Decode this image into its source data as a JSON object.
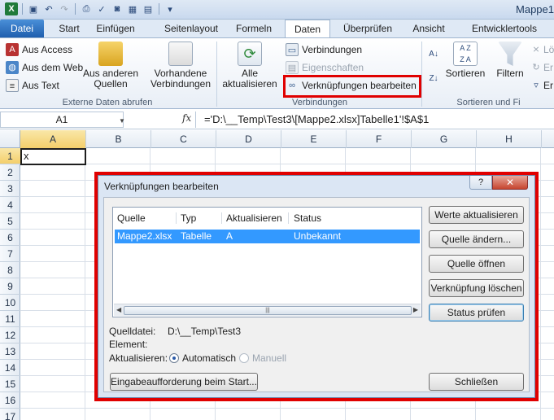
{
  "window": {
    "title": "Mappe1"
  },
  "tabs": [
    {
      "label": "Datei"
    },
    {
      "label": "Start"
    },
    {
      "label": "Einfügen"
    },
    {
      "label": "Seitenlayout"
    },
    {
      "label": "Formeln"
    },
    {
      "label": "Daten"
    },
    {
      "label": "Überprüfen"
    },
    {
      "label": "Ansicht"
    },
    {
      "label": "Entwicklertools"
    }
  ],
  "ribbon": {
    "external": {
      "access": "Aus Access",
      "web": "Aus dem Web",
      "text": "Aus Text",
      "other": "Aus anderen Quellen",
      "existing": "Vorhandene Verbindungen",
      "group_label": "Externe Daten abrufen"
    },
    "connections": {
      "refresh_all": "Alle aktualisieren",
      "connections": "Verbindungen",
      "properties": "Eigenschaften",
      "edit_links": "Verknüpfungen bearbeiten",
      "group_label": "Verbindungen"
    },
    "sort": {
      "sort_label": "Sortieren",
      "filter_label": "Filtern",
      "delete_partial": "Lö",
      "reapply_partial": "Er",
      "advanced_partial": "Er",
      "group_label": "Sortieren und Fi"
    }
  },
  "formula_bar": {
    "name_box": "A1",
    "fx": "fx",
    "formula": "='D:\\__Temp\\Test3\\[Mappe2.xlsx]Tabelle1'!$A$1"
  },
  "grid": {
    "columns": [
      "A",
      "B",
      "C",
      "D",
      "E",
      "F",
      "G",
      "H"
    ],
    "rows": [
      "1",
      "2",
      "3",
      "4",
      "5",
      "6",
      "7",
      "8",
      "9",
      "10",
      "11",
      "12",
      "13",
      "14",
      "15",
      "16",
      "17"
    ],
    "a1_value": "x"
  },
  "dialog": {
    "title": "Verknüpfungen bearbeiten",
    "help": "?",
    "close": "✕",
    "list_headers": [
      "Quelle",
      "Typ",
      "Aktualisieren",
      "Status"
    ],
    "rows": [
      {
        "quelle": "Mappe2.xlsx",
        "typ": "Tabelle",
        "aktualisieren": "A",
        "status": "Unbekannt"
      }
    ],
    "buttons": {
      "update": "Werte aktualisieren",
      "change": "Quelle ändern...",
      "open": "Quelle öffnen",
      "break": "Verknüpfung löschen",
      "check": "Status prüfen",
      "startup": "Eingabeaufforderung beim Start...",
      "close": "Schließen"
    },
    "info": {
      "source_label": "Quelldatei:",
      "source_value": "D:\\__Temp\\Test3",
      "element_label": "Element:",
      "update_label": "Aktualisieren:",
      "auto": "Automatisch",
      "manual": "Manuell"
    }
  },
  "colors": {
    "highlight": "#e00000",
    "selection": "#3399ff",
    "file_tab": "#2a6cc0"
  }
}
